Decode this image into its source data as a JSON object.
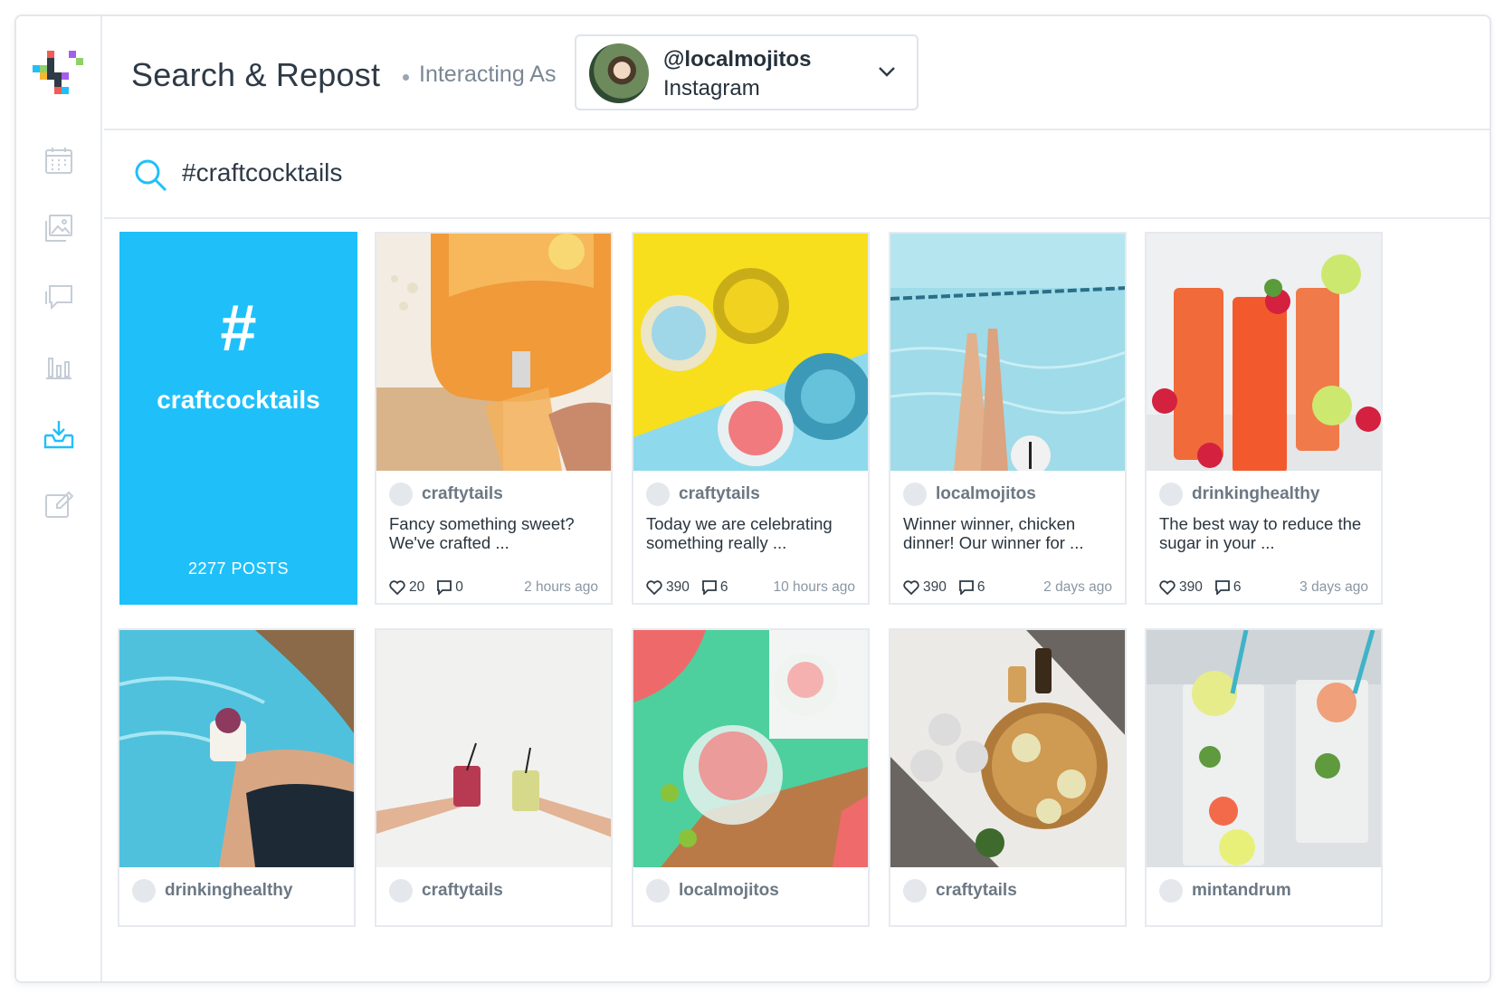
{
  "header": {
    "title": "Search & Repost",
    "subtitle": "Interacting As",
    "account": {
      "handle": "@localmojitos",
      "platform": "Instagram"
    }
  },
  "sidebar": {
    "items": [
      {
        "icon": "calendar-icon"
      },
      {
        "icon": "image-gallery-icon"
      },
      {
        "icon": "chat-icon"
      },
      {
        "icon": "bar-chart-icon"
      },
      {
        "icon": "download-inbox-icon",
        "active": true
      },
      {
        "icon": "edit-icon"
      }
    ]
  },
  "search": {
    "value": "#craftcocktails"
  },
  "hashtag": {
    "symbol": "#",
    "name": "craftcocktails",
    "count": "2277 POSTS"
  },
  "posts": [
    {
      "username": "craftytails",
      "caption": "Fancy something sweet? We've crafted ...",
      "likes": "20",
      "comments": "0",
      "time": "2 hours ago"
    },
    {
      "username": "craftytails",
      "caption": "Today we are celebrating something really ...",
      "likes": "390",
      "comments": "6",
      "time": "10 hours ago"
    },
    {
      "username": "localmojitos",
      "caption": "Winner winner, chicken dinner! Our winner for ...",
      "likes": "390",
      "comments": "6",
      "time": "2 days ago"
    },
    {
      "username": "drinkinghealthy",
      "caption": "The best way to reduce the sugar in your ...",
      "likes": "390",
      "comments": "6",
      "time": "3 days ago"
    },
    {
      "username": "drinkinghealthy"
    },
    {
      "username": "craftytails"
    },
    {
      "username": "localmojitos"
    },
    {
      "username": "craftytails"
    },
    {
      "username": "mintandrum"
    }
  ],
  "colors": {
    "accent": "#1fc0fa",
    "border": "#e6eaef",
    "muted": "#8a96a3"
  }
}
